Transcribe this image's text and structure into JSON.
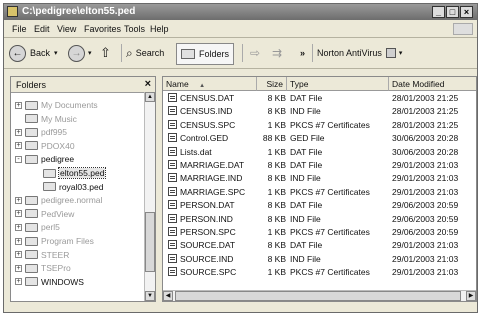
{
  "window": {
    "title": "C:\\pedigree\\elton55.ped",
    "buttons": [
      "_",
      "□",
      "×"
    ]
  },
  "menu": [
    "File",
    "Edit",
    "View",
    "Favorites",
    "Tools",
    "Help"
  ],
  "toolbar": {
    "back_label": "Back",
    "search_label": "Search",
    "folders_label": "Folders",
    "overflow": "»",
    "antivirus_label": "Norton AntiVirus"
  },
  "folders_pane": {
    "title": "Folders",
    "close": "×",
    "items": [
      {
        "label": "My Documents",
        "expander": "+",
        "dim": true
      },
      {
        "label": "My Music",
        "expander": "",
        "dim": true
      },
      {
        "label": "pdf995",
        "expander": "+",
        "dim": true
      },
      {
        "label": "PDOX40",
        "expander": "+",
        "dim": true
      },
      {
        "label": "pedigree",
        "expander": "-",
        "dim": false
      },
      {
        "label": "elton55.ped",
        "expander": "",
        "dim": false,
        "selected": true
      },
      {
        "label": "royal03.ped",
        "expander": "",
        "dim": false
      },
      {
        "label": "pedigree.normal",
        "expander": "+",
        "dim": true
      },
      {
        "label": "PedView",
        "expander": "+",
        "dim": true
      },
      {
        "label": "perl5",
        "expander": "+",
        "dim": true
      },
      {
        "label": "Program Files",
        "expander": "+",
        "dim": true
      },
      {
        "label": "STEER",
        "expander": "+",
        "dim": true
      },
      {
        "label": "TSEPro",
        "expander": "+",
        "dim": true
      },
      {
        "label": "WINDOWS",
        "expander": "+",
        "dim": false
      }
    ]
  },
  "file_list": {
    "columns": [
      "Name",
      "Size",
      "Type",
      "Date Modified"
    ],
    "sort_indicator": "▲",
    "rows": [
      {
        "name": "CENSUS.DAT",
        "size": "8 KB",
        "type": "DAT File",
        "date": "28/01/2003 21:25"
      },
      {
        "name": "CENSUS.IND",
        "size": "8 KB",
        "type": "IND File",
        "date": "28/01/2003 21:25"
      },
      {
        "name": "CENSUS.SPC",
        "size": "1 KB",
        "type": "PKCS #7 Certificates",
        "date": "28/01/2003 21:25"
      },
      {
        "name": "Control.GED",
        "size": "88 KB",
        "type": "GED File",
        "date": "30/06/2003 20:28"
      },
      {
        "name": "Lists.dat",
        "size": "1 KB",
        "type": "DAT File",
        "date": "30/06/2003 20:28"
      },
      {
        "name": "MARRIAGE.DAT",
        "size": "8 KB",
        "type": "DAT File",
        "date": "29/01/2003 21:03"
      },
      {
        "name": "MARRIAGE.IND",
        "size": "8 KB",
        "type": "IND File",
        "date": "29/01/2003 21:03"
      },
      {
        "name": "MARRIAGE.SPC",
        "size": "1 KB",
        "type": "PKCS #7 Certificates",
        "date": "29/01/2003 21:03"
      },
      {
        "name": "PERSON.DAT",
        "size": "8 KB",
        "type": "DAT File",
        "date": "29/06/2003 20:59"
      },
      {
        "name": "PERSON.IND",
        "size": "8 KB",
        "type": "IND File",
        "date": "29/06/2003 20:59"
      },
      {
        "name": "PERSON.SPC",
        "size": "1 KB",
        "type": "PKCS #7 Certificates",
        "date": "29/06/2003 20:59"
      },
      {
        "name": "SOURCE.DAT",
        "size": "8 KB",
        "type": "DAT File",
        "date": "29/01/2003 21:03"
      },
      {
        "name": "SOURCE.IND",
        "size": "8 KB",
        "type": "IND File",
        "date": "29/01/2003 21:03"
      },
      {
        "name": "SOURCE.SPC",
        "size": "1 KB",
        "type": "PKCS #7 Certificates",
        "date": "29/01/2003 21:03"
      }
    ]
  }
}
